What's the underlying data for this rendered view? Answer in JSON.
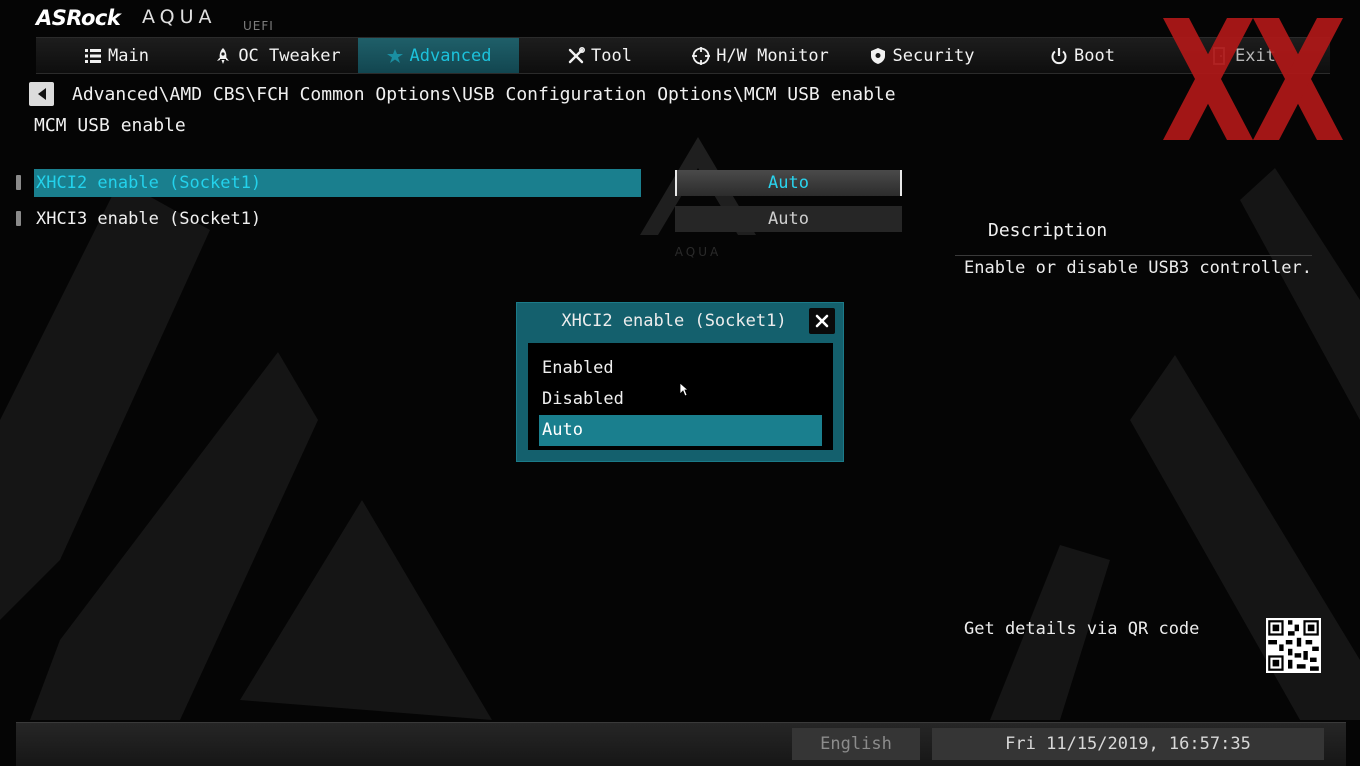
{
  "brand": {
    "logo": "ASRock",
    "product": "AQUA",
    "edition": "UEFI"
  },
  "colors": {
    "accent": "#1cc2dc",
    "selection": "#1a7f8e",
    "popup": "#14606d",
    "xx_mark": "#c01a1a"
  },
  "nav": {
    "tabs": [
      {
        "label": "Main",
        "icon": "list-icon"
      },
      {
        "label": "OC Tweaker",
        "icon": "rocket-icon"
      },
      {
        "label": "Advanced",
        "icon": "star-icon",
        "active": true
      },
      {
        "label": "Tool",
        "icon": "tools-icon"
      },
      {
        "label": "H/W Monitor",
        "icon": "crosshair-icon"
      },
      {
        "label": "Security",
        "icon": "shield-icon"
      },
      {
        "label": "Boot",
        "icon": "power-icon"
      },
      {
        "label": "Exit",
        "icon": "exit-door-icon"
      }
    ]
  },
  "breadcrumb": "Advanced\\AMD CBS\\FCH Common Options\\USB Configuration Options\\MCM USB enable",
  "page_title": "MCM USB enable",
  "options": [
    {
      "label": "XHCI2 enable (Socket1)",
      "value": "Auto",
      "selected": true
    },
    {
      "label": "XHCI3 enable (Socket1)",
      "value": "Auto",
      "selected": false
    }
  ],
  "description": {
    "title": "Description",
    "text": "Enable or disable USB3 controller."
  },
  "qr": {
    "label": "Get details via QR code"
  },
  "popup": {
    "title": "XHCI2 enable (Socket1)",
    "items": [
      "Enabled",
      "Disabled",
      "Auto"
    ],
    "selected": "Auto"
  },
  "footer": {
    "language": "English",
    "datetime": "Fri 11/15/2019, 16:57:35"
  }
}
